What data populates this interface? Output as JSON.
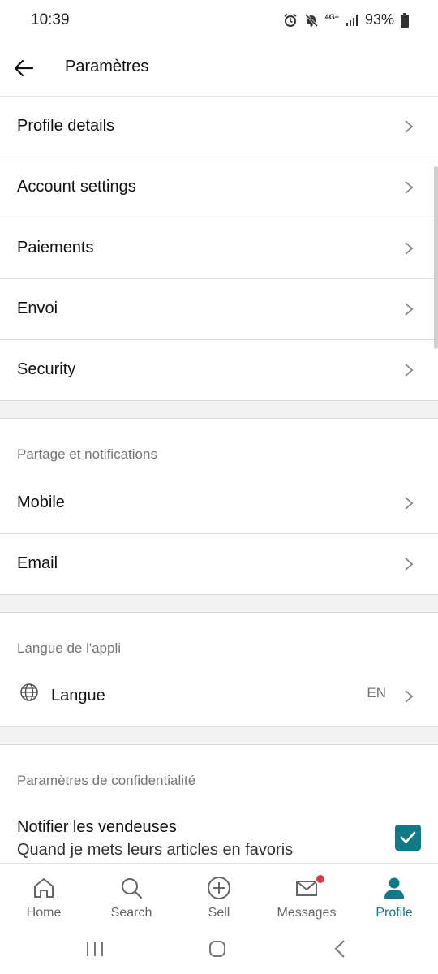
{
  "status": {
    "time": "10:39",
    "network": "4G+",
    "battery": "93%"
  },
  "header": {
    "title": "Paramètres"
  },
  "account_items": [
    {
      "label": "Profile details"
    },
    {
      "label": "Account settings"
    },
    {
      "label": "Paiements"
    },
    {
      "label": "Envoi"
    },
    {
      "label": "Security"
    }
  ],
  "sharing": {
    "header": "Partage et notifications",
    "items": [
      {
        "label": "Mobile"
      },
      {
        "label": "Email"
      }
    ]
  },
  "language": {
    "header": "Langue de l'appli",
    "label": "Langue",
    "value": "EN"
  },
  "privacy": {
    "header": "Paramètres de confidentialité",
    "notify_title": "Notifier les vendeuses",
    "notify_subtitle": "Quand je mets leurs articles en favoris",
    "notify_checked": true
  },
  "nav": {
    "items": [
      {
        "label": "Home",
        "icon": "home-icon"
      },
      {
        "label": "Search",
        "icon": "search-icon"
      },
      {
        "label": "Sell",
        "icon": "plus-circle-icon"
      },
      {
        "label": "Messages",
        "icon": "mail-icon"
      },
      {
        "label": "Profile",
        "icon": "person-icon"
      }
    ],
    "active_index": 4,
    "messages_badge": true
  },
  "colors": {
    "accent": "#117a87",
    "badge": "#e0394d",
    "divider": "#dcdcdc",
    "section_gap": "#f2f2f2"
  }
}
